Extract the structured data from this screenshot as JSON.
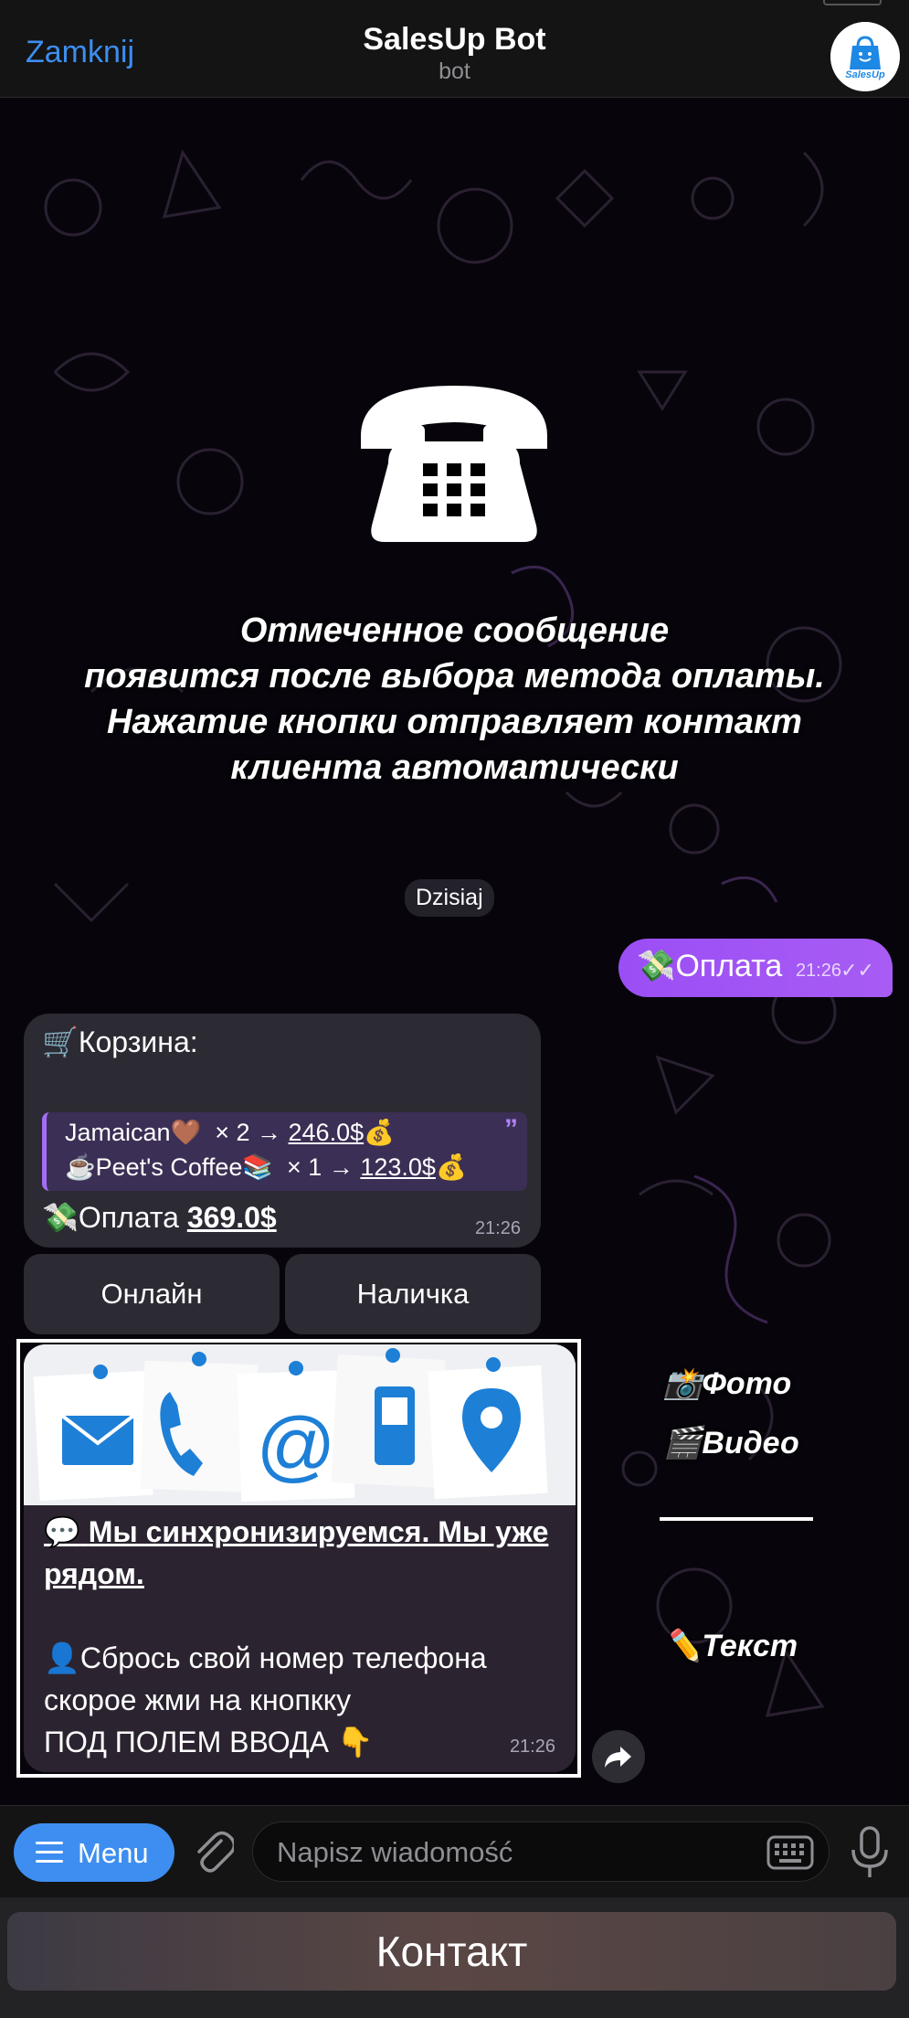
{
  "header": {
    "close_label": "Zamknij",
    "title": "SalesUp Bot",
    "subtitle": "bot",
    "avatar_text": "SalesUp"
  },
  "intro": {
    "text_lines": [
      "Отмеченное сообщение",
      "появится после выбора метода оплаты.",
      "Нажатие кнопки отправляет контакт",
      "клиента автоматически"
    ]
  },
  "chat": {
    "date_chip": "Dzisiaj",
    "outgoing": {
      "emoji": "💸",
      "text": "Оплата",
      "time": "21:26",
      "status_icon": "double-check-icon"
    },
    "cart": {
      "title_emoji": "🛒",
      "title": "Корзина:",
      "items": [
        {
          "emoji_before": "",
          "name": "Jamaican🤎",
          "qty": "× 2 →",
          "price": "246.0$",
          "emoji_after": "💰"
        },
        {
          "emoji_before": "☕️",
          "name": "Peet's Coffee📚",
          "qty": "× 1 →",
          "price": "123.0$",
          "emoji_after": "💰"
        }
      ],
      "total_emoji": "💸",
      "total_label": "Оплата",
      "total_value": "369.0$",
      "time": "21:26"
    },
    "inline_buttons": [
      "Онлайн",
      "Наличка"
    ],
    "media_message": {
      "image_alt": "contact-icons-pinned-notes",
      "line1_emoji": "💬",
      "line1": "Мы синхронизируемся. Мы уже рядом.",
      "line2_emoji": "👤",
      "line2": "Сбрось свой номер телефона скорое жми на кнопкку",
      "line3": "ПОД ПОЛЕМ ВВОДА",
      "line3_emoji": "👇",
      "time": "21:26"
    },
    "side_labels": {
      "photo_emoji": "📸",
      "photo": "Фото",
      "video_emoji": "🎬",
      "video": "Видео",
      "text_emoji": "✏️",
      "text": "Текст"
    }
  },
  "input_bar": {
    "menu_label": "Menu",
    "placeholder": "Napisz wiadomość"
  },
  "reply_keyboard": {
    "button_label": "Контакт"
  },
  "colors": {
    "accent_blue": "#3d8ef0",
    "outgoing_bubble": "#a256f5",
    "incoming_bubble": "#2c2a33",
    "quote_bar": "#a56df5"
  }
}
